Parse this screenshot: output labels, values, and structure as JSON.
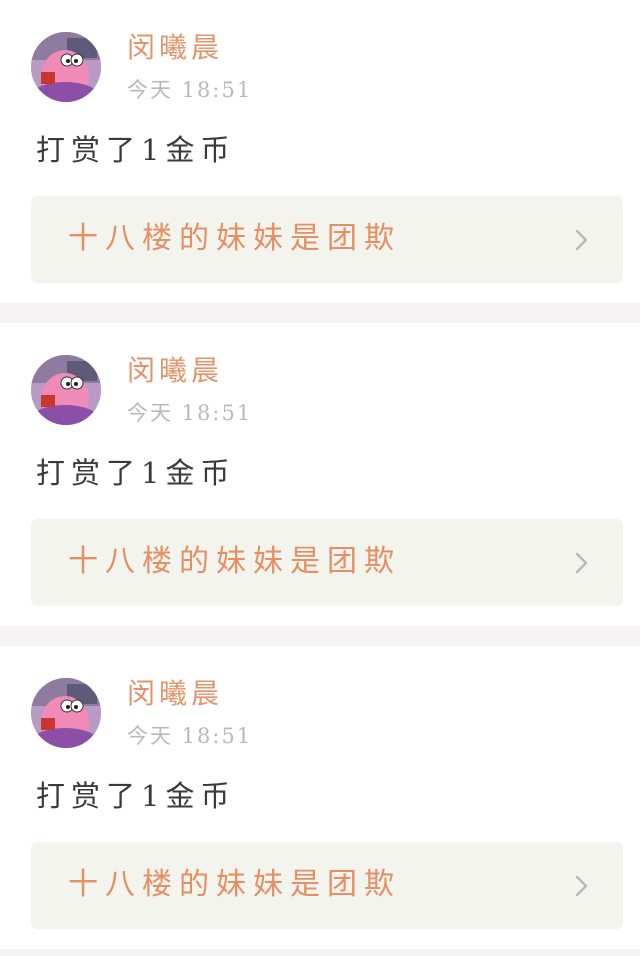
{
  "feed": {
    "items": [
      {
        "user_name": "闵曦晨",
        "time": "今天 18:51",
        "message": "打赏了1金币",
        "target_title": "十八楼的妹妹是团欺"
      },
      {
        "user_name": "闵曦晨",
        "time": "今天 18:51",
        "message": "打赏了1金币",
        "target_title": "十八楼的妹妹是团欺"
      },
      {
        "user_name": "闵曦晨",
        "time": "今天 18:51",
        "message": "打赏了1金币",
        "target_title": "十八楼的妹妹是团欺"
      }
    ]
  },
  "colors": {
    "accent": "#e3946a",
    "muted": "#b9b9b9",
    "card_link_bg": "#f4f4ee",
    "divider": "#f5f3f3"
  },
  "icons": {
    "avatar": "avatar-cartoon-star",
    "chevron": "chevron-right-icon"
  }
}
